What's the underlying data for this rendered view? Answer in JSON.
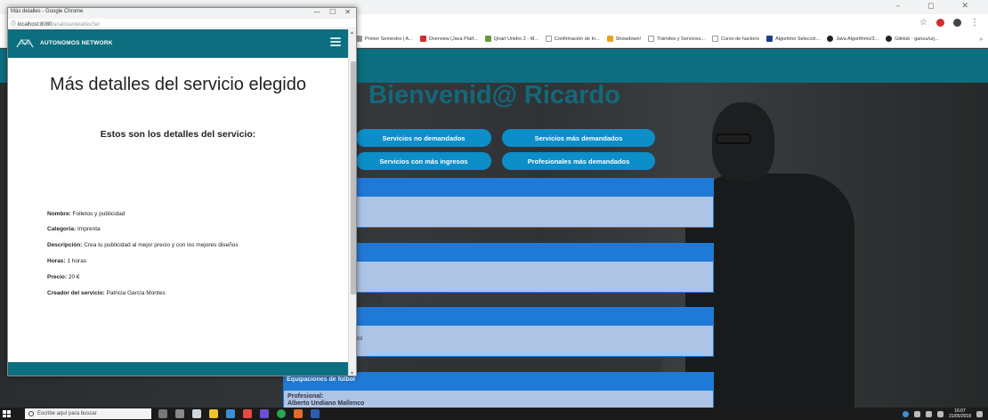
{
  "popup": {
    "window_title": "Más detalles - Google Chrome",
    "address_host": "localhost:8080",
    "address_path": "/analista/detallesSer",
    "brand": "AUTONOMOS NETWORK",
    "heading": "Más detalles del servicio elegido",
    "subheading": "Estos son los detalles del servicio:",
    "details": [
      {
        "label": "Nombre:",
        "value": "Folletos y publicidad"
      },
      {
        "label": "Categoría:",
        "value": "Imprenta"
      },
      {
        "label": "Descripción:",
        "value": "Crea tu publicidad al mejor precio y con los mejores diseños"
      },
      {
        "label": "Horas:",
        "value": "1 horas"
      },
      {
        "label": "Precio:",
        "value": "20 €"
      },
      {
        "label": "Creador del servicio:",
        "value": "Patricia García Montes"
      }
    ],
    "controls": {
      "minimize": "—",
      "maximize": "☐",
      "close": "✕"
    }
  },
  "main": {
    "window_controls": "–  ◻  ✕",
    "bookmarks": [
      "Primer Semestre | A...",
      "Overview (Java Platf...",
      "Qnart Unidro 2 - M...",
      "Confirmación de In...",
      "Showdown!",
      "Trámites y Servicios...",
      "Curso de hackers",
      "Algoritmo Selecció...",
      "Java Algorithms/3...",
      "GitHub - ganuu/urj..."
    ],
    "welcome": "Bienvenid@ Ricardo",
    "buttons": [
      "Servicios no demandados",
      "Servicios más demandados",
      "Servicios con más ingresos",
      "Profesionales más demandados"
    ],
    "partial_text": "co",
    "card_last": {
      "title": "Equipaciones de fútbol",
      "prof_label": "Profesional:",
      "prof_name": "Alberto Undiano Mallenco"
    }
  },
  "taskbar": {
    "search_placeholder": "Escribe aquí para buscar",
    "time": "16:07",
    "date": "31/05/2018"
  },
  "colors": {
    "teal": "#0c6e7e",
    "pill_blue": "#0c8ec9",
    "card_header": "#1f79d6",
    "card_body": "#aec4e4"
  }
}
